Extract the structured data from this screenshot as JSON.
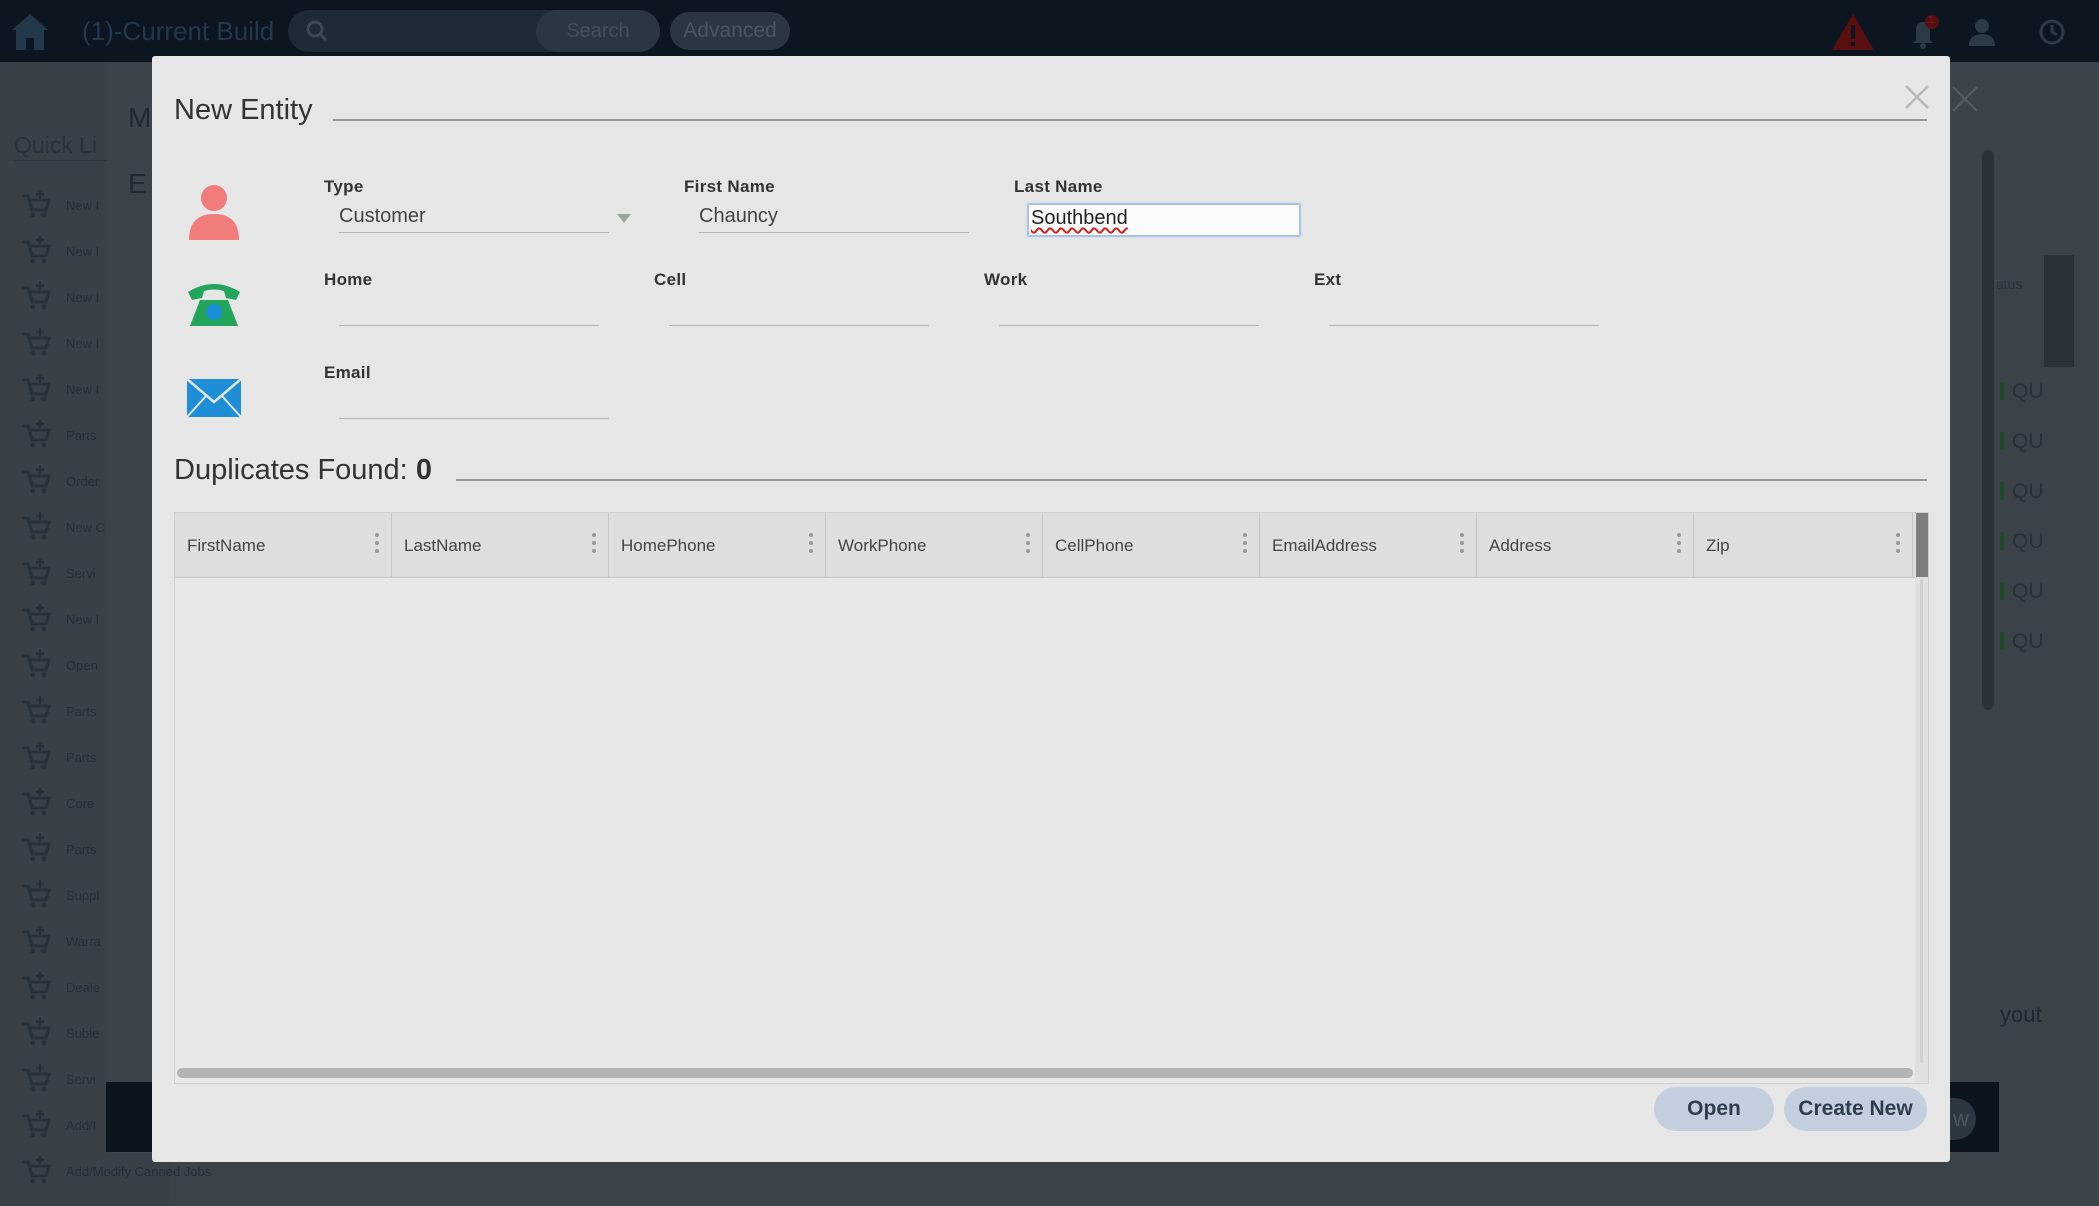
{
  "app": {
    "title": "(1)-Current Build",
    "search_button": "Search",
    "advanced_button": "Advanced",
    "notification_count": "1"
  },
  "sidebar": {
    "title": "Quick Li",
    "items": [
      "New I",
      "New I",
      "New I",
      "New I",
      "New I",
      "Parts",
      "Order",
      "New C",
      "Servi",
      "New I",
      "Open",
      "Parts",
      "Parts",
      "Core",
      "Parts",
      "Suppl",
      "Warra",
      "Deale",
      "Suble",
      "Servi",
      "Add/I",
      "Add/Modify Canned Jobs"
    ]
  },
  "background_panel": {
    "heading_m": "M",
    "heading_e": "E",
    "status_text": "atus",
    "rows": [
      "QU",
      "QU",
      "QU",
      "QU",
      "QU",
      "QU"
    ],
    "layout_text": "yout",
    "button_fragment": "w"
  },
  "modal": {
    "title": "New Entity",
    "type_label": "Type",
    "type_value": "Customer",
    "first_name_label": "First Name",
    "first_name_value": "Chauncy",
    "last_name_label": "Last Name",
    "last_name_value": "Southbend",
    "home_label": "Home",
    "home_value": "",
    "cell_label": "Cell",
    "cell_value": "",
    "work_label": "Work",
    "work_value": "",
    "ext_label": "Ext",
    "ext_value": "",
    "email_label": "Email",
    "email_value": "",
    "duplicates_label": "Duplicates Found:",
    "duplicates_count": "0",
    "columns": [
      "FirstName",
      "LastName",
      "HomePhone",
      "WorkPhone",
      "CellPhone",
      "EmailAddress",
      "Address",
      "Zip"
    ],
    "open_button": "Open",
    "create_button": "Create New"
  },
  "colors": {
    "person_icon": "#f07c7c",
    "phone_icon": "#22a55a",
    "email_icon": "#1e8fd6",
    "button_bg": "#c3cfdc"
  }
}
